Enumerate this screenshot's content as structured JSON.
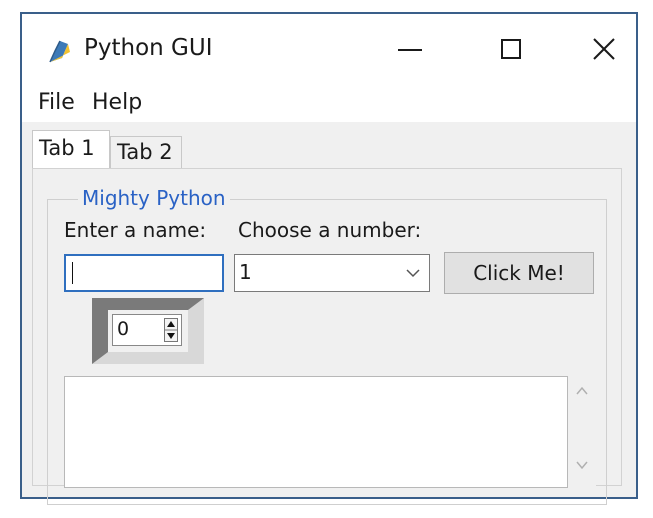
{
  "window": {
    "title": "Python GUI",
    "icon": "python-feather-icon"
  },
  "menubar": {
    "items": [
      {
        "label": "File"
      },
      {
        "label": "Help"
      }
    ]
  },
  "tabs": [
    {
      "label": "Tab 1",
      "selected": true
    },
    {
      "label": "Tab 2",
      "selected": false
    }
  ],
  "frame": {
    "title": "Mighty Python",
    "name_label": "Enter a name:",
    "number_label": "Choose a number:",
    "name_value": "",
    "combo_value": "1",
    "button_label": "Click Me!",
    "spin_value": "0",
    "text_area_value": ""
  },
  "colors": {
    "frame_title": "#2a62c5",
    "entry_focus_border": "#2f6fbf",
    "window_border": "#3a5f8a"
  }
}
